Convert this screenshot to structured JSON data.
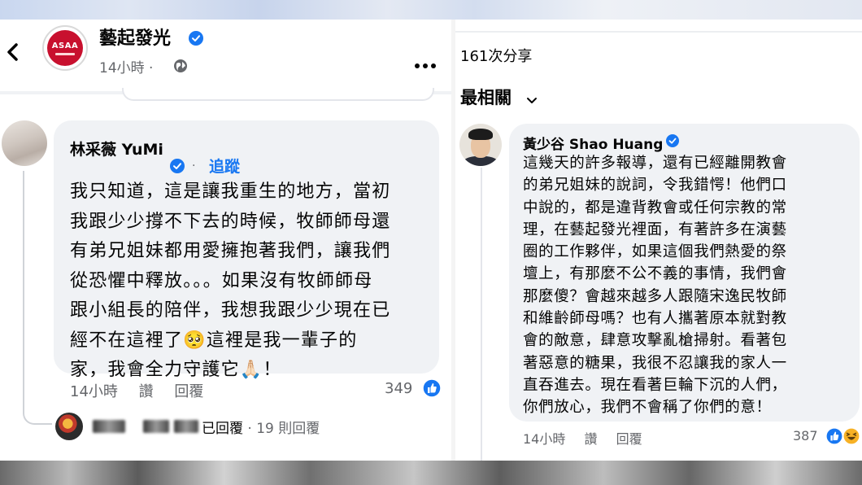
{
  "left": {
    "page": {
      "name": "藝起發光",
      "time": "14小時 ·",
      "avatar_text": "ASAA"
    },
    "comment": {
      "author": "林采薇 YuMi",
      "follow_label": "追蹤",
      "dot": "·",
      "text": "我只知道，這是讓我重生的地方，當初\n我跟少少撐不下去的時候，牧師師母還\n有弟兄姐妹都用愛擁抱著我們，讓我們\n從恐懼中釋放。。。如果沒有牧師師母\n跟小組長的陪伴，我想我跟少少現在已\n經不在這裡了🥺這裡是我一輩子的\n家，我會全力守護它🙏🏻！",
      "time": "14小時",
      "like_label": "讚",
      "reply_label": "回覆",
      "reaction_count": "349"
    },
    "reply_summary": {
      "replied_label": "已回覆",
      "count_label": "· 19 則回覆"
    }
  },
  "right": {
    "shares": "161次分享",
    "sort_label": "最相關",
    "comment": {
      "author": "黃少谷 Shao Huang",
      "text": "這幾天的許多報導，還有已經離開教會\n的弟兄姐妹的說詞，令我錯愕！他們口\n中說的，都是違背教會或任何宗教的常\n理，在藝起發光裡面，有著許多在演藝\n圈的工作夥伴，如果這個我們熱愛的祭\n壇上，有那麼不公不義的事情，我們會\n那麼傻？會越來越多人跟隨宋逸民牧師\n和維齡師母嗎？也有人攜著原本就對教\n會的敵意，肆意攻擊亂槍掃射。看著包\n著惡意的糖果，我很不忍讓我的家人一\n直吞進去。現在看著巨輪下沉的人們，\n你們放心，我們不會稱了你們的意！",
      "time": "14小時",
      "like_label": "讚",
      "reply_label": "回覆",
      "reaction_count": "387"
    }
  },
  "colors": {
    "facebook_blue": "#1877f2",
    "bubble_bg": "#f0f2f5",
    "secondary_text": "#65676b",
    "brand_red": "#c8102e"
  },
  "icons": [
    "back-arrow-icon",
    "verified-badge-icon",
    "globe-icon",
    "more-options-icon",
    "chevron-down-icon",
    "like-reaction-icon",
    "haha-reaction-icon"
  ]
}
